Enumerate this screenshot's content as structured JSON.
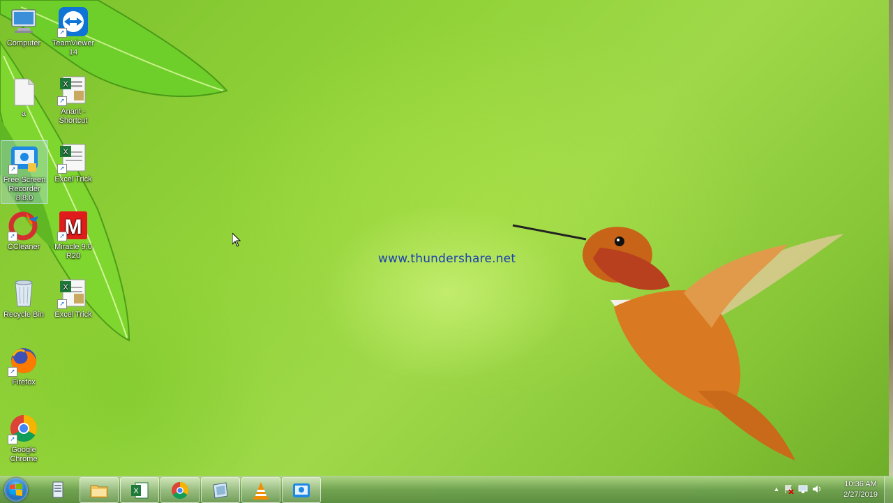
{
  "desktop": {
    "icons": [
      {
        "label": "Computer"
      },
      {
        "label": "TeamViewer 14"
      },
      {
        "label": "a"
      },
      {
        "label": "Anant - Shortcut"
      },
      {
        "label": "Free Screen Recorder 8.8.0"
      },
      {
        "label": "Excel Trick"
      },
      {
        "label": "CCleaner"
      },
      {
        "label": "Miracle 9.0 R20"
      },
      {
        "label": "Recycle Bin"
      },
      {
        "label": "Excel Trick"
      },
      {
        "label": "Firefox"
      },
      {
        "label": "Google Chrome"
      }
    ],
    "watermark": "www.thundershare.net"
  },
  "taskbar": {
    "pinned": [
      "start-orb",
      "taskmgr-icon",
      "explorer-icon",
      "excel-icon",
      "chrome-icon",
      "generic-app-icon",
      "vlc-icon",
      "screen-recorder-icon"
    ],
    "clock_time": "10:36 AM",
    "clock_date": "2/27/2019"
  },
  "colors": {
    "accent": "#1b3fb0",
    "taskbar": "#6ea050"
  }
}
